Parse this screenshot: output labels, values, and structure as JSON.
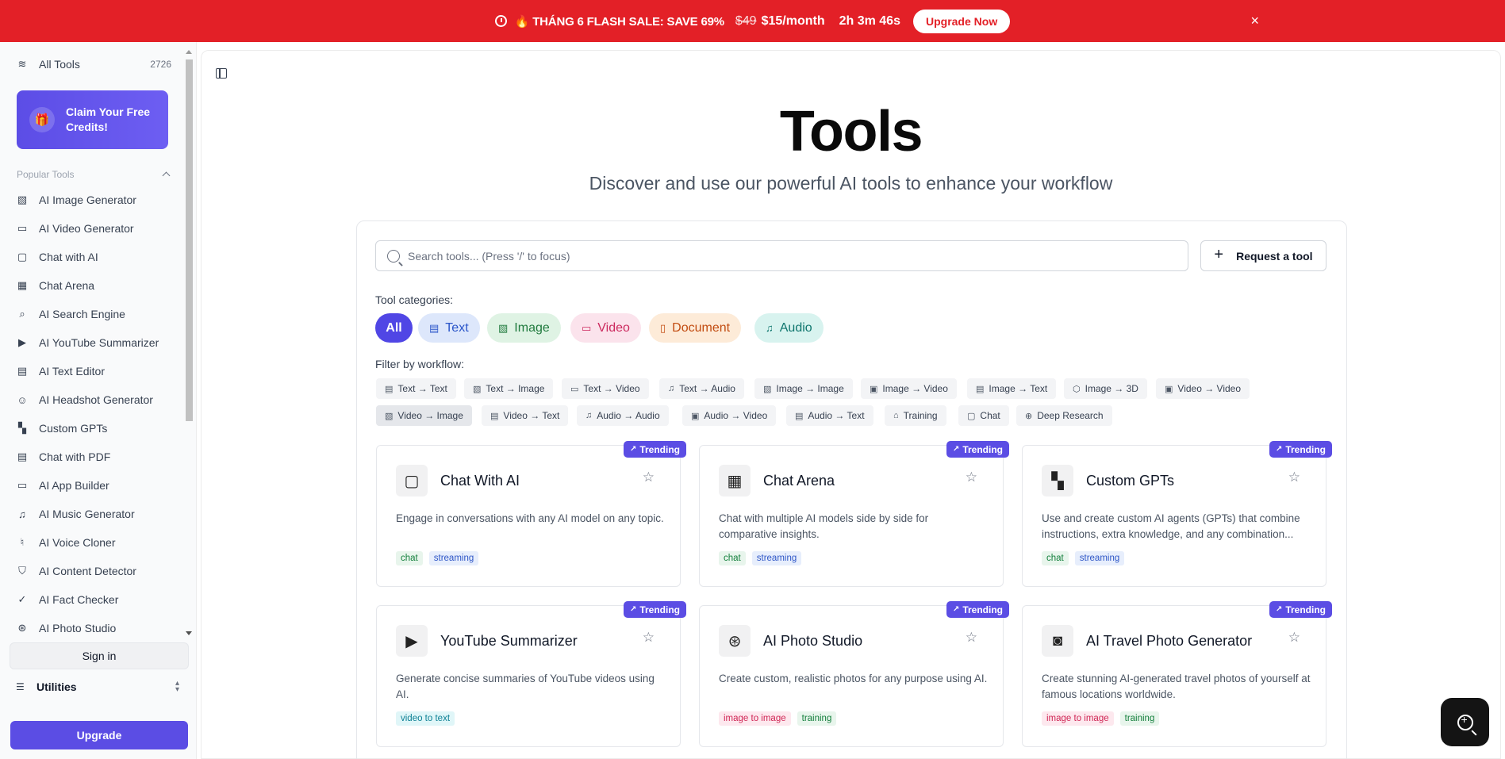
{
  "banner": {
    "sale_text": "🔥 THÁNG 6 FLASH SALE: SAVE 69%",
    "old_price": "$49",
    "price": "$15/month",
    "timer": "2h 3m 46s",
    "cta": "Upgrade Now",
    "close": "×"
  },
  "sidebar": {
    "all_tools": {
      "label": "All Tools",
      "count": "2726"
    },
    "claim": "Claim Your Free Credits!",
    "section": "Popular Tools",
    "items": [
      {
        "label": "AI Image Generator",
        "icon": "image-icon"
      },
      {
        "label": "AI Video Generator",
        "icon": "video-icon"
      },
      {
        "label": "Chat with AI",
        "icon": "message-icon"
      },
      {
        "label": "Chat Arena",
        "icon": "grid-icon"
      },
      {
        "label": "AI Search Engine",
        "icon": "search-icon"
      },
      {
        "label": "AI YouTube Summarizer",
        "icon": "youtube-icon"
      },
      {
        "label": "AI Text Editor",
        "icon": "document-icon"
      },
      {
        "label": "AI Headshot Generator",
        "icon": "user-icon"
      },
      {
        "label": "Custom GPTs",
        "icon": "apps-icon"
      },
      {
        "label": "Chat with PDF",
        "icon": "file-text-icon"
      },
      {
        "label": "AI App Builder",
        "icon": "window-icon"
      },
      {
        "label": "AI Music Generator",
        "icon": "music-icon"
      },
      {
        "label": "AI Voice Cloner",
        "icon": "mic-icon"
      },
      {
        "label": "AI Content Detector",
        "icon": "shield-icon"
      },
      {
        "label": "AI Fact Checker",
        "icon": "check-circle-icon"
      },
      {
        "label": "AI Photo Studio",
        "icon": "aperture-icon"
      }
    ],
    "sign_in": "Sign in",
    "utilities": "Utilities",
    "upgrade": "Upgrade"
  },
  "main": {
    "title": "Tools",
    "subtitle": "Discover and use our powerful AI tools to enhance your workflow",
    "search_placeholder": "Search tools... (Press '/' to focus)",
    "request": "Request a tool",
    "categories_label": "Tool categories:",
    "categories": [
      "All",
      "Text",
      "Image",
      "Video",
      "Document",
      "Audio"
    ],
    "workflow_label": "Filter by workflow:",
    "workflows_row1": [
      "Text → Text",
      "Text → Image",
      "Text → Video",
      "Text → Audio",
      "Image → Image",
      "Image → Video",
      "Image → Text",
      "Image → 3D",
      "Video → Video"
    ],
    "workflows_row2": [
      "Video → Image",
      "Video → Text",
      "Audio → Audio",
      "Audio → Video",
      "Audio → Text",
      "Training",
      "Chat",
      "Deep Research"
    ],
    "trending": "Trending",
    "tools": [
      {
        "name": "Chat With AI",
        "desc": "Engage in conversations with any AI model on any topic.",
        "tags": [
          "chat",
          "streaming"
        ]
      },
      {
        "name": "Chat Arena",
        "desc": "Chat with multiple AI models side by side for comparative insights.",
        "tags": [
          "chat",
          "streaming"
        ]
      },
      {
        "name": "Custom GPTs",
        "desc": "Use and create custom AI agents (GPTs) that combine instructions, extra knowledge, and any combination...",
        "tags": [
          "chat",
          "streaming"
        ]
      },
      {
        "name": "YouTube Summarizer",
        "desc": "Generate concise summaries of YouTube videos using AI.",
        "tags": [
          "video to text"
        ]
      },
      {
        "name": "AI Photo Studio",
        "desc": "Create custom, realistic photos for any purpose using AI.",
        "tags": [
          "image to image",
          "training"
        ]
      },
      {
        "name": "AI Travel Photo Generator",
        "desc": "Create stunning AI-generated travel photos of yourself at famous locations worldwide.",
        "tags": [
          "image to image",
          "training"
        ]
      }
    ]
  },
  "colors": {
    "brand": "#5b4de4",
    "banner": "#e32027"
  }
}
